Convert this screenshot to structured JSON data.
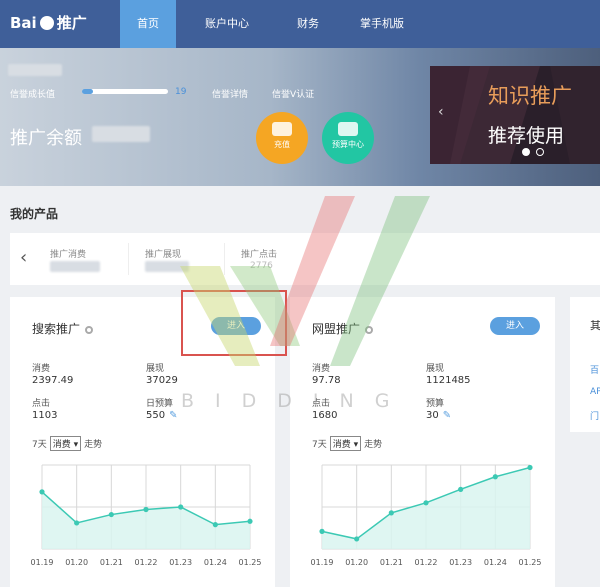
{
  "header": {
    "logo_text": "Bai",
    "logo_suffix": "推广",
    "nav": [
      "首页",
      "账户中心",
      "财务",
      "掌手机版"
    ]
  },
  "hero": {
    "credit_growth_label": "信誉成长值",
    "credit_growth_value": "19",
    "credit_growth_progress": 0.13,
    "credit_detail_link": "信誉详情",
    "credit_v_link": "信誉V认证",
    "balance_title": "推广余额",
    "recharge_label": "充值",
    "budget_center_label": "预算中心"
  },
  "banner": {
    "line1": "知识推广",
    "line2": "推荐使用",
    "prev_arrow": "‹"
  },
  "products": {
    "title": "我的产品",
    "strip_labels": [
      "推广消费",
      "推广展现",
      "推广点击"
    ],
    "strip_partial_value": "2776"
  },
  "search_card": {
    "title": "搜索推广",
    "enter_label": "进入",
    "metrics": {
      "spend_label": "消费",
      "spend_value": "2397.49",
      "impr_label": "展现",
      "impr_value": "37029",
      "click_label": "点击",
      "click_value": "1103",
      "budget_label": "日预算",
      "budget_value": "550"
    },
    "period_label": "7天",
    "select_value": "消费",
    "trend_label": "走势"
  },
  "union_card": {
    "title": "网盟推广",
    "enter_label": "进入",
    "metrics": {
      "spend_label": "消费",
      "spend_value": "97.78",
      "impr_label": "展现",
      "impr_value": "1121485",
      "click_label": "点击",
      "click_value": "1680",
      "budget_label": "预算",
      "budget_value": "30"
    },
    "period_label": "7天",
    "select_value": "消费",
    "trend_label": "走势"
  },
  "side_card": {
    "title": "其",
    "items": [
      "百",
      "AP",
      "门"
    ]
  },
  "watermark": {
    "text": "BIDDING"
  },
  "colors": {
    "nav_bg": "#3f5f99",
    "nav_active": "#5ba0df",
    "accent_orange": "#f5a623",
    "accent_green": "#22c6a3",
    "chart_line": "#3cc9b4",
    "chart_fill": "#d9f5f0",
    "highlight_box": "#d9534f"
  },
  "chart_data": [
    {
      "type": "area",
      "categories": [
        "01.19",
        "01.20",
        "01.21",
        "01.22",
        "01.23",
        "01.24",
        "01.25"
      ],
      "series": [
        {
          "values": [
            0.68,
            0.31,
            0.41,
            0.47,
            0.5,
            0.29,
            0.33
          ]
        }
      ],
      "ylim": [
        0,
        1
      ],
      "grid": true
    },
    {
      "type": "area",
      "categories": [
        "01.19",
        "01.20",
        "01.21",
        "01.22",
        "01.23",
        "01.24",
        "01.25"
      ],
      "series": [
        {
          "values": [
            0.21,
            0.12,
            0.43,
            0.55,
            0.71,
            0.86,
            0.97
          ]
        }
      ],
      "ylim": [
        0,
        1
      ],
      "grid": true
    }
  ]
}
